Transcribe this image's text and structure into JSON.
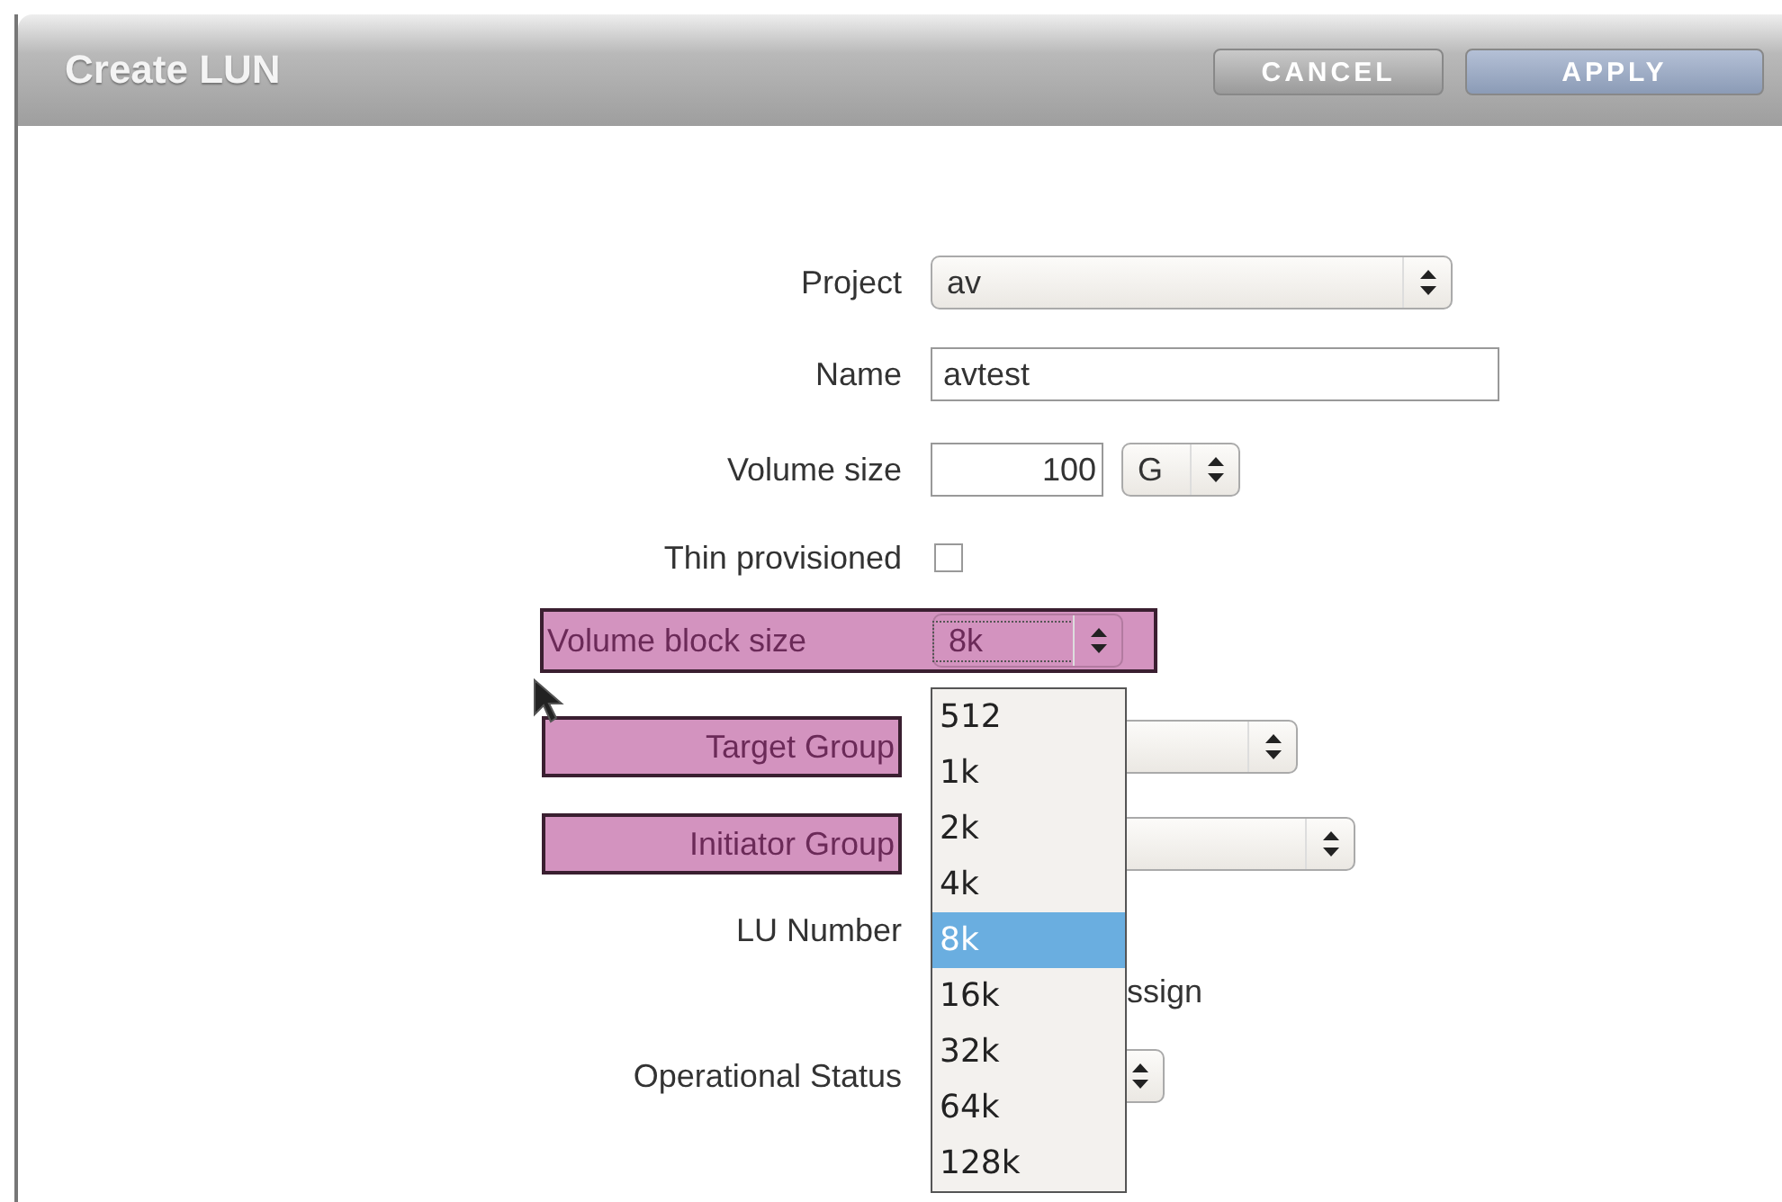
{
  "dialog": {
    "title": "Create LUN",
    "buttons": [
      {
        "label": "CANCEL",
        "kind": "cancel"
      },
      {
        "label": "APPLY",
        "kind": "apply"
      }
    ]
  },
  "fields": [
    {
      "label": "Project",
      "kind": "select",
      "value": "av",
      "highlighted": false
    },
    {
      "label": "Name",
      "kind": "text",
      "value": "avtest",
      "highlighted": false
    },
    {
      "label": "Volume size",
      "kind": "size",
      "value": "100",
      "unit": "G",
      "highlighted": false
    },
    {
      "label": "Thin provisioned",
      "kind": "checkbox",
      "checked": false,
      "highlighted": false
    },
    {
      "label": "Volume block size",
      "kind": "select",
      "value": "8k",
      "highlighted": true,
      "open": true,
      "options": [
        {
          "label": "512",
          "selected": false
        },
        {
          "label": "1k",
          "selected": false
        },
        {
          "label": "2k",
          "selected": false
        },
        {
          "label": "4k",
          "selected": false
        },
        {
          "label": "8k",
          "selected": true
        },
        {
          "label": "16k",
          "selected": false
        },
        {
          "label": "32k",
          "selected": false
        },
        {
          "label": "64k",
          "selected": false
        },
        {
          "label": "128k",
          "selected": false
        }
      ]
    },
    {
      "label": "Target Group",
      "kind": "select",
      "highlighted": true
    },
    {
      "label": "Initiator Group",
      "kind": "select",
      "highlighted": true
    },
    {
      "label": "LU Number",
      "kind": "covered",
      "highlighted": false
    },
    {
      "label": "ssign",
      "kind": "cut-text",
      "highlighted": false
    },
    {
      "label": "Operational Status",
      "kind": "select",
      "highlighted": false
    }
  ]
}
